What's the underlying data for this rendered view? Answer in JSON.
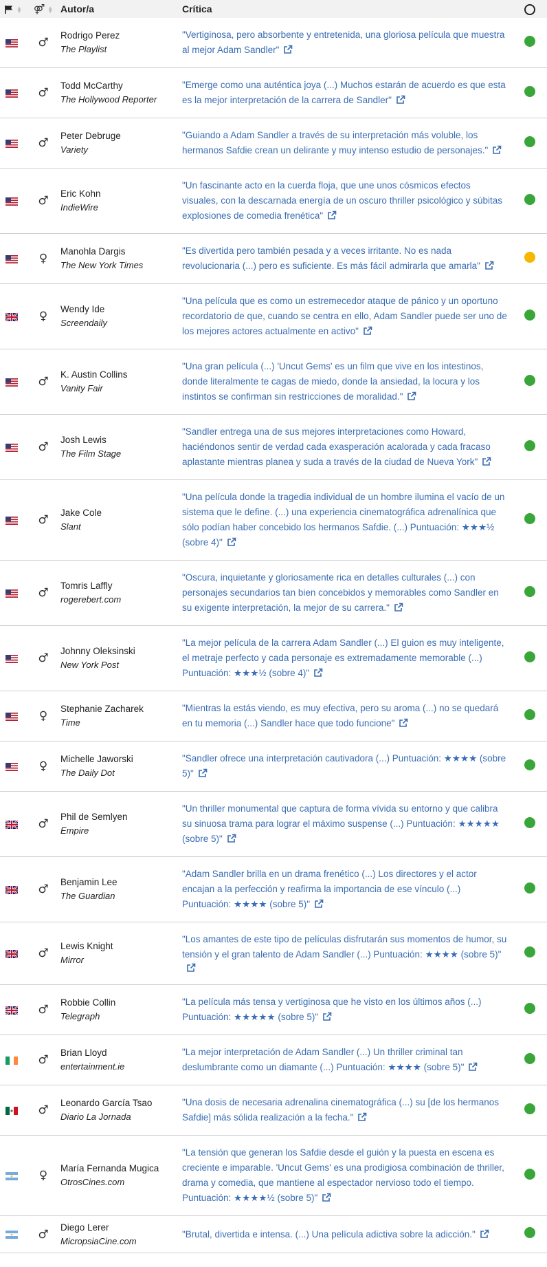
{
  "header": {
    "author_label": "Autor/a",
    "review_label": "Crítica"
  },
  "colors": {
    "positive": "#3aa63a",
    "mixed": "#f5b700",
    "link": "#3a6db3"
  },
  "rows": [
    {
      "flag": "us",
      "gender": "male",
      "name": "Rodrigo Perez",
      "outlet": "The Playlist",
      "quote": "\"Vertiginosa, pero absorbente y entretenida, una gloriosa película que muestra al mejor Adam Sandler\"",
      "rating": "positive"
    },
    {
      "flag": "us",
      "gender": "male",
      "name": "Todd McCarthy",
      "outlet": "The Hollywood Reporter",
      "quote": "\"Emerge como una auténtica joya (...) Muchos estarán de acuerdo es que esta es la mejor interpretación de la carrera de Sandler\"",
      "rating": "positive"
    },
    {
      "flag": "us",
      "gender": "male",
      "name": "Peter Debruge",
      "outlet": "Variety",
      "quote": "\"Guiando a Adam Sandler a través de su interpretación más voluble, los hermanos Safdie crean un delirante y muy intenso estudio de personajes.\"",
      "rating": "positive"
    },
    {
      "flag": "us",
      "gender": "male",
      "name": "Eric Kohn",
      "outlet": "IndieWire",
      "quote": "\"Un fascinante acto en la cuerda floja, que une unos cósmicos efectos visuales, con la descarnada energía de un oscuro thriller psicológico y súbitas explosiones de comedia frenética\"",
      "rating": "positive"
    },
    {
      "flag": "us",
      "gender": "female",
      "name": "Manohla Dargis",
      "outlet": "The New York Times",
      "quote": "\"Es divertida pero también pesada y a veces irritante. No es nada revolucionaria (...) pero es suficiente. Es más fácil admirarla que amarla\"",
      "rating": "mixed"
    },
    {
      "flag": "uk",
      "gender": "female",
      "name": "Wendy Ide",
      "outlet": "Screendaily",
      "quote": "\"Una película que es como un estremecedor ataque de pánico y un oportuno recordatorio de que, cuando se centra en ello, Adam Sandler puede ser uno de los mejores actores actualmente en activo\"",
      "rating": "positive"
    },
    {
      "flag": "us",
      "gender": "male",
      "name": "K. Austin Collins",
      "outlet": "Vanity Fair",
      "quote": "\"Una gran película (...) 'Uncut Gems' es un film que vive en los intestinos, donde literalmente te cagas de miedo, donde la ansiedad, la locura y los instintos se confirman sin restricciones de moralidad.\"",
      "rating": "positive"
    },
    {
      "flag": "us",
      "gender": "male",
      "name": "Josh Lewis",
      "outlet": "The Film Stage",
      "quote": "\"Sandler entrega una de sus mejores interpretaciones como Howard, haciéndonos sentir de verdad cada exasperación acalorada y cada fracaso aplastante mientras planea y suda a través de la ciudad de Nueva York\"",
      "rating": "positive"
    },
    {
      "flag": "us",
      "gender": "male",
      "name": "Jake Cole",
      "outlet": "Slant",
      "quote": "\"Una película donde la tragedia individual de un hombre ilumina el vacío de un sistema que le define. (...) una experiencia cinematográfica adrenalínica que sólo podían haber concebido los hermanos Safdie. (...) Puntuación: ★★★½ (sobre 4)\"",
      "rating": "positive"
    },
    {
      "flag": "us",
      "gender": "male",
      "name": "Tomris Laffly",
      "outlet": "rogerebert.com",
      "quote": "\"Oscura, inquietante y gloriosamente rica en detalles culturales (...) con personajes secundarios tan bien concebidos y memorables como Sandler en su exigente interpretación, la mejor de su carrera.\"",
      "rating": "positive"
    },
    {
      "flag": "us",
      "gender": "male",
      "name": "Johnny Oleksinski",
      "outlet": "New York Post",
      "quote": "\"La mejor película de la carrera Adam Sandler (...) El guion es muy inteligente, el metraje perfecto y cada personaje es extremadamente memorable (...) Puntuación: ★★★½ (sobre 4)\"",
      "rating": "positive"
    },
    {
      "flag": "us",
      "gender": "female",
      "name": "Stephanie Zacharek",
      "outlet": "Time",
      "quote": "\"Mientras la estás viendo, es muy efectiva, pero su aroma (...) no se quedará en tu memoria (...) Sandler hace que todo funcione\"",
      "rating": "positive"
    },
    {
      "flag": "us",
      "gender": "female",
      "name": "Michelle Jaworski",
      "outlet": "The Daily Dot",
      "quote": "\"Sandler ofrece una interpretación cautivadora (...) Puntuación: ★★★★ (sobre 5)\"",
      "rating": "positive"
    },
    {
      "flag": "uk",
      "gender": "male",
      "name": "Phil de Semlyen",
      "outlet": "Empire",
      "quote": "\"Un thriller monumental que captura de forma vívida su entorno y que calibra su sinuosa trama para lograr el máximo suspense (...) Puntuación: ★★★★★ (sobre 5)\"",
      "rating": "positive"
    },
    {
      "flag": "uk",
      "gender": "male",
      "name": "Benjamin Lee",
      "outlet": "The Guardian",
      "quote": "\"Adam Sandler brilla en un drama frenético (...) Los directores y el actor encajan a la perfección y reafirma la importancia de ese vínculo (...) Puntuación: ★★★★ (sobre 5)\"",
      "rating": "positive"
    },
    {
      "flag": "uk",
      "gender": "male",
      "name": "Lewis Knight",
      "outlet": "Mirror",
      "quote": "\"Los amantes de este tipo de películas disfrutarán sus momentos de humor, su tensión y el gran talento de Adam Sandler (...) Puntuación: ★★★★ (sobre 5)\"",
      "rating": "positive"
    },
    {
      "flag": "uk",
      "gender": "male",
      "name": "Robbie Collin",
      "outlet": "Telegraph",
      "quote": "\"La película más tensa y vertiginosa que he visto en los últimos años (...) Puntuación: ★★★★★ (sobre 5)\"",
      "rating": "positive"
    },
    {
      "flag": "ie",
      "gender": "male",
      "name": "Brian Lloyd",
      "outlet": "entertainment.ie",
      "quote": "\"La mejor interpretación de Adam Sandler (...) Un thriller criminal tan deslumbrante como un diamante (...) Puntuación: ★★★★ (sobre 5)\"",
      "rating": "positive"
    },
    {
      "flag": "mx",
      "gender": "male",
      "name": "Leonardo García Tsao",
      "outlet": "Diario La Jornada",
      "quote": "\"Una dosis de necesaria adrenalina cinematográfica (...) su [de los hermanos Safdie] más sólida realización a la fecha.\"",
      "rating": "positive"
    },
    {
      "flag": "ar",
      "gender": "female",
      "name": "María Fernanda Mugica",
      "outlet": "OtrosCines.com",
      "quote": "\"La tensión que generan los Safdie desde el guión y la puesta en escena es creciente e imparable. 'Uncut Gems' es una prodigiosa combinación de thriller, drama y comedia, que mantiene al espectador nervioso todo el tiempo. Puntuación: ★★★★½ (sobre 5)\"",
      "rating": "positive"
    },
    {
      "flag": "ar",
      "gender": "male",
      "name": "Diego Lerer",
      "outlet": "MicropsiaCine.com",
      "quote": "\"Brutal, divertida e intensa. (...) Una película adictiva sobre la adicción.\"",
      "rating": "positive"
    }
  ]
}
